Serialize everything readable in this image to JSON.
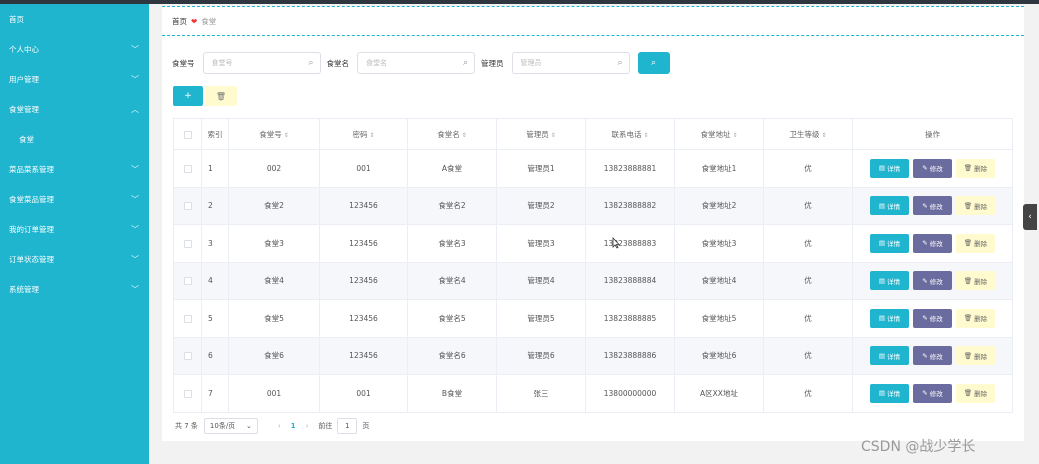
{
  "sidebar": {
    "items": [
      {
        "label": "首页",
        "chevron": ""
      },
      {
        "label": "个人中心",
        "chevron": "﹀"
      },
      {
        "label": "用户管理",
        "chevron": "﹀"
      },
      {
        "label": "食堂管理",
        "chevron": "︿"
      },
      {
        "label": "食堂",
        "chevron": "",
        "sub": true
      },
      {
        "label": "菜品菜系管理",
        "chevron": "﹀"
      },
      {
        "label": "食堂菜品管理",
        "chevron": "﹀"
      },
      {
        "label": "我的订单管理",
        "chevron": "﹀"
      },
      {
        "label": "订单状态管理",
        "chevron": "﹀"
      },
      {
        "label": "系统管理",
        "chevron": "﹀"
      }
    ]
  },
  "breadcrumb": {
    "home": "首页",
    "sep": "❤",
    "current": "食堂"
  },
  "filters": [
    {
      "label": "食堂号",
      "placeholder": "食堂号"
    },
    {
      "label": "食堂名",
      "placeholder": "食堂名"
    },
    {
      "label": "管理员",
      "placeholder": "管理员"
    }
  ],
  "buttons": {
    "search": "⌕",
    "add": "+",
    "delete": "🗑"
  },
  "table": {
    "headers": [
      "索引",
      "食堂号",
      "密码",
      "食堂名",
      "管理员",
      "联系电话",
      "食堂地址",
      "卫生等级",
      "操作"
    ],
    "rows": [
      [
        "1",
        "002",
        "001",
        "A食堂",
        "管理员1",
        "13823888881",
        "食堂地址1",
        "优"
      ],
      [
        "2",
        "食堂2",
        "123456",
        "食堂名2",
        "管理员2",
        "13823888882",
        "食堂地址2",
        "优"
      ],
      [
        "3",
        "食堂3",
        "123456",
        "食堂名3",
        "管理员3",
        "13823888883",
        "食堂地址3",
        "优"
      ],
      [
        "4",
        "食堂4",
        "123456",
        "食堂名4",
        "管理员4",
        "13823888884",
        "食堂地址4",
        "优"
      ],
      [
        "5",
        "食堂5",
        "123456",
        "食堂名5",
        "管理员5",
        "13823888885",
        "食堂地址5",
        "优"
      ],
      [
        "6",
        "食堂6",
        "123456",
        "食堂名6",
        "管理员6",
        "13823888886",
        "食堂地址6",
        "优"
      ],
      [
        "7",
        "001",
        "001",
        "B食堂",
        "张三",
        "13800000000",
        "A区XX地址",
        "优"
      ]
    ],
    "ops": {
      "detail": "详情",
      "edit": "修改",
      "delete": "删除"
    }
  },
  "pager": {
    "total": "共 7 条",
    "size": "10条/页",
    "current": "1",
    "goto": "前往",
    "page_input": "1",
    "page_unit": "页"
  },
  "watermark": "CSDN @战少学长",
  "colors": {
    "accent": "#1fb5cf",
    "edit": "#6a6b9e",
    "warn": "#fffbcf"
  }
}
